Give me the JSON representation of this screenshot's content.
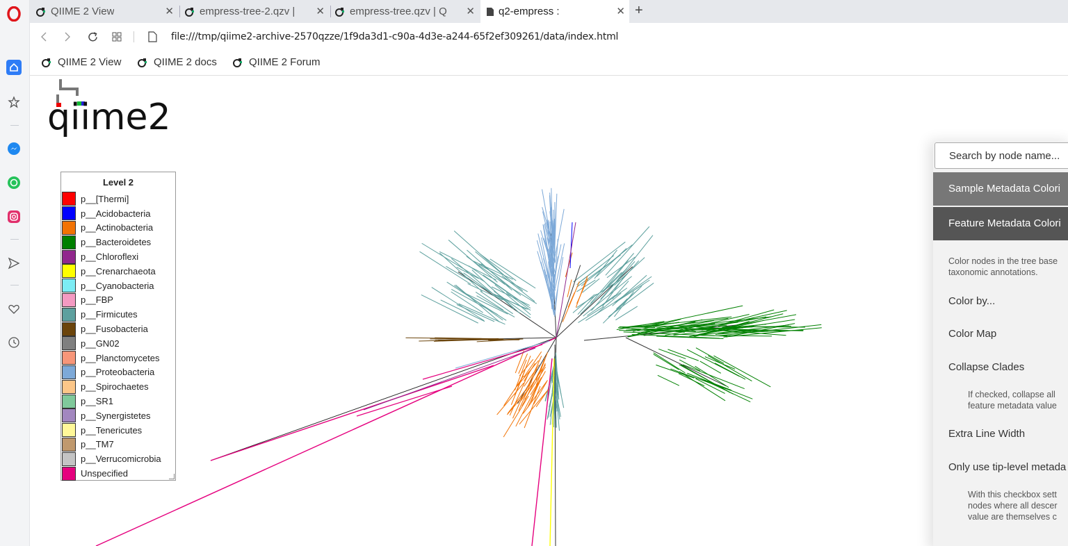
{
  "browser": {
    "tabs": [
      {
        "title": "QIIME 2 View",
        "close": "✕"
      },
      {
        "title": "empress-tree-2.qzv |",
        "close": "✕"
      },
      {
        "title": "empress-tree.qzv | Q",
        "close": "✕"
      },
      {
        "title": "q2-empress :",
        "close": "✕"
      }
    ],
    "new_tab": "+",
    "url": "file:///tmp/qiime2-archive-2570qzze/1f9da3d1-c90a-4d3e-a244-65f2ef309261/data/index.html",
    "bookmarks": [
      "QIIME 2 View",
      "QIIME 2 docs",
      "QIIME 2 Forum"
    ]
  },
  "logo": {
    "text": "qiime2"
  },
  "legend": {
    "title": "Level 2",
    "items": [
      {
        "label": "p__[Thermi]",
        "color": "#ff0000"
      },
      {
        "label": "p__Acidobacteria",
        "color": "#0000ff"
      },
      {
        "label": "p__Actinobacteria",
        "color": "#f27304"
      },
      {
        "label": "p__Bacteroidetes",
        "color": "#008000"
      },
      {
        "label": "p__Chloroflexi",
        "color": "#91278d"
      },
      {
        "label": "p__Crenarchaeota",
        "color": "#ffff00"
      },
      {
        "label": "p__Cyanobacteria",
        "color": "#7cecf4"
      },
      {
        "label": "p__FBP",
        "color": "#f49ac2"
      },
      {
        "label": "p__Firmicutes",
        "color": "#5da09e"
      },
      {
        "label": "p__Fusobacteria",
        "color": "#6b440b"
      },
      {
        "label": "p__GN02",
        "color": "#808080"
      },
      {
        "label": "p__Planctomycetes",
        "color": "#f79679"
      },
      {
        "label": "p__Proteobacteria",
        "color": "#7da9d8"
      },
      {
        "label": "p__Spirochaetes",
        "color": "#fcc688"
      },
      {
        "label": "p__SR1",
        "color": "#80c99b"
      },
      {
        "label": "p__Synergistetes",
        "color": "#a287bf"
      },
      {
        "label": "p__Tenericutes",
        "color": "#fff899"
      },
      {
        "label": "p__TM7",
        "color": "#c0996e"
      },
      {
        "label": "p__Verrucomicrobia",
        "color": "#c4c4c4"
      },
      {
        "label": "Unspecified",
        "color": "#e5007e"
      }
    ]
  },
  "panel": {
    "search_placeholder": "Search by node name...",
    "sample_metadata": "Sample Metadata Colori",
    "feature_metadata": "Feature Metadata Colori",
    "desc_line1": "Color nodes in the tree base",
    "desc_line2": "taxonomic annotations.",
    "color_by": "Color by...",
    "color_map": "Color Map",
    "collapse_clades": "Collapse Clades",
    "collapse_note1": "If checked, collapse all",
    "collapse_note2": "feature metadata value",
    "extra_line_width": "Extra Line Width",
    "tip_level": "Only use tip-level metada",
    "tip_note1": "With this checkbox sett",
    "tip_note2": "nodes where all descer",
    "tip_note3": "value are themselves c"
  }
}
